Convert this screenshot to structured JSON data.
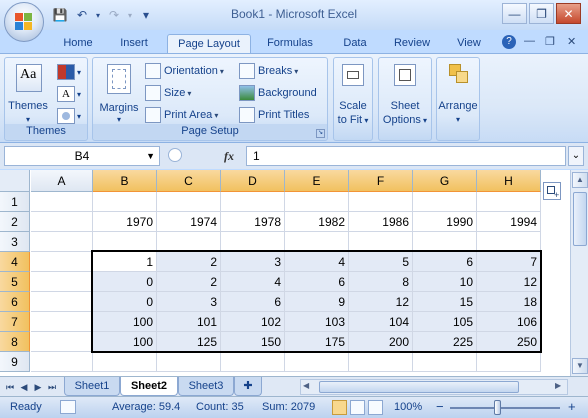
{
  "window": {
    "title": "Book1 - Microsoft Excel",
    "minimize": "—",
    "restore": "❐",
    "close": "✕"
  },
  "qat": {
    "save": "💾",
    "undo": "↶",
    "redo": "↷",
    "more": "▾"
  },
  "tabs": [
    {
      "label": "Home"
    },
    {
      "label": "Insert"
    },
    {
      "label": "Page Layout"
    },
    {
      "label": "Formulas"
    },
    {
      "label": "Data"
    },
    {
      "label": "Review"
    },
    {
      "label": "View"
    }
  ],
  "ribbon": {
    "themes_group": {
      "label": "Themes",
      "themes_button": "Themes"
    },
    "page_setup_group": {
      "label": "Page Setup",
      "margins": "Margins",
      "orientation": "Orientation",
      "size": "Size",
      "print_area": "Print Area",
      "breaks": "Breaks",
      "background": "Background",
      "print_titles": "Print Titles"
    },
    "scale_to_fit": {
      "line1": "Scale",
      "line2": "to Fit"
    },
    "sheet_options": {
      "line1": "Sheet",
      "line2": "Options"
    },
    "arrange": {
      "label": "Arrange"
    }
  },
  "formula_bar": {
    "name_box": "B4",
    "fx": "fx",
    "value": "1"
  },
  "grid": {
    "columns": [
      "A",
      "B",
      "C",
      "D",
      "E",
      "F",
      "G",
      "H"
    ],
    "rows": [
      "1",
      "2",
      "3",
      "4",
      "5",
      "6",
      "7",
      "8",
      "9"
    ],
    "cells": [
      [
        "",
        "",
        "",
        "",
        "",
        "",
        "",
        ""
      ],
      [
        "",
        "1970",
        "1974",
        "1978",
        "1982",
        "1986",
        "1990",
        "1994"
      ],
      [
        "",
        "",
        "",
        "",
        "",
        "",
        "",
        ""
      ],
      [
        "",
        "1",
        "2",
        "3",
        "4",
        "5",
        "6",
        "7"
      ],
      [
        "",
        "0",
        "2",
        "4",
        "6",
        "8",
        "10",
        "12"
      ],
      [
        "",
        "0",
        "3",
        "6",
        "9",
        "12",
        "15",
        "18"
      ],
      [
        "",
        "100",
        "101",
        "102",
        "103",
        "104",
        "105",
        "106"
      ],
      [
        "",
        "100",
        "125",
        "150",
        "175",
        "200",
        "225",
        "250"
      ],
      [
        "",
        "",
        "",
        "",
        "",
        "",
        "",
        ""
      ]
    ],
    "selected_columns": [
      "B",
      "C",
      "D",
      "E",
      "F",
      "G",
      "H"
    ],
    "selected_rows": [
      "4",
      "5",
      "6",
      "7",
      "8"
    ]
  },
  "sheets": [
    {
      "label": "Sheet1"
    },
    {
      "label": "Sheet2"
    },
    {
      "label": "Sheet3"
    }
  ],
  "status": {
    "ready": "Ready",
    "average": "Average: 59.4",
    "count": "Count: 35",
    "sum": "Sum: 2079",
    "zoom": "100%",
    "zoom_out": "−",
    "zoom_in": "+"
  }
}
